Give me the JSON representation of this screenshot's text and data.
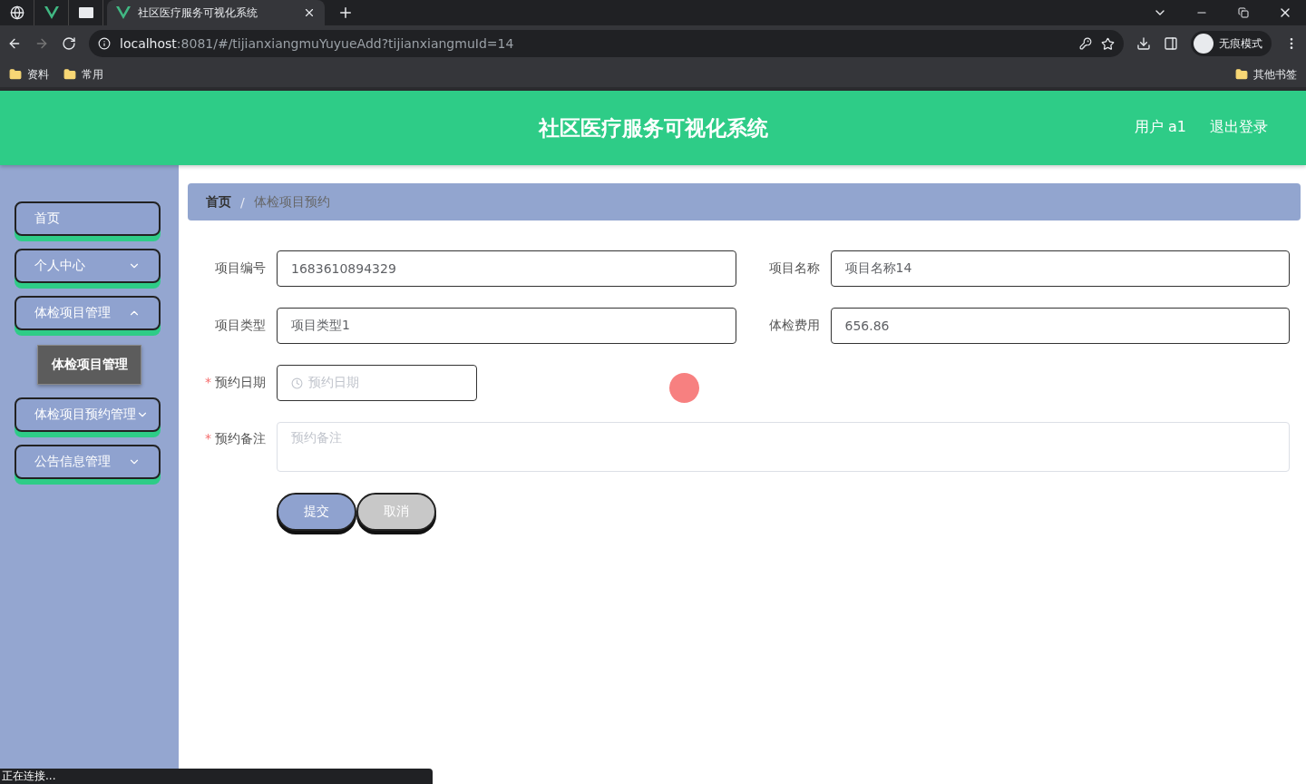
{
  "browser": {
    "tab_title": "社区医疗服务可视化系统",
    "address_host": "localhost",
    "address_rest": ":8081/#/tijianxiangmuYuyueAdd?tijianxiangmuId=14",
    "profile": "无痕模式",
    "bookmarks": [
      "资料",
      "常用"
    ],
    "other_bookmarks": "其他书签"
  },
  "header": {
    "title": "社区医疗服务可视化系统",
    "user": "用户 a1",
    "logout": "退出登录"
  },
  "sidebar": {
    "items": [
      {
        "label": "首页",
        "kind": "link"
      },
      {
        "label": "个人中心",
        "kind": "menu",
        "expanded": false
      },
      {
        "label": "体检项目管理",
        "kind": "menu",
        "expanded": true,
        "children": [
          {
            "label": "体检项目管理"
          }
        ]
      },
      {
        "label": "体检项目预约管理",
        "kind": "menu",
        "expanded": false
      },
      {
        "label": "公告信息管理",
        "kind": "menu",
        "expanded": false
      }
    ]
  },
  "breadcrumb": {
    "items": [
      "首页",
      "体检项目预约"
    ],
    "separator": "/"
  },
  "form": {
    "fields": [
      {
        "label": "项目编号",
        "kind": "text",
        "value": "1683610894329"
      },
      {
        "label": "项目名称",
        "kind": "text",
        "value": "项目名称14"
      },
      {
        "label": "项目类型",
        "kind": "text",
        "value": "项目类型1"
      },
      {
        "label": "体检费用",
        "kind": "text",
        "value": "656.86"
      },
      {
        "label": "预约日期",
        "kind": "date",
        "placeholder": "预约日期",
        "required_mark": "*"
      },
      {
        "label": "预约备注",
        "kind": "textarea",
        "placeholder": "预约备注",
        "required_mark": "*"
      }
    ],
    "buttons": [
      {
        "label": "提交",
        "kind": "primary"
      },
      {
        "label": "取消",
        "kind": "secondary"
      }
    ]
  },
  "status_bar": "正在连接..."
}
